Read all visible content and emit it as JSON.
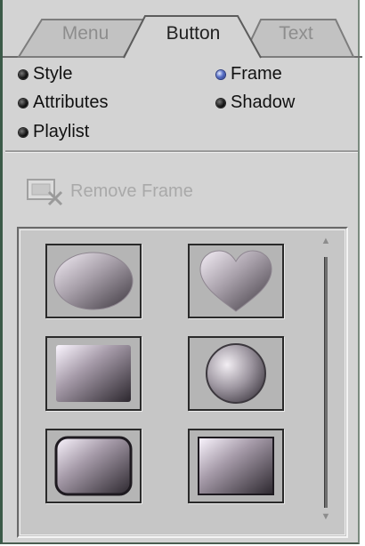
{
  "tabs": [
    {
      "label": "Menu",
      "active": false
    },
    {
      "label": "Button",
      "active": true
    },
    {
      "label": "Text",
      "active": false
    }
  ],
  "options": {
    "style": {
      "label": "Style",
      "selected": false
    },
    "attributes": {
      "label": "Attributes",
      "selected": false
    },
    "playlist": {
      "label": "Playlist",
      "selected": false
    },
    "frame": {
      "label": "Frame",
      "selected": true
    },
    "shadow": {
      "label": "Shadow",
      "selected": false
    }
  },
  "remove_frame": {
    "label": "Remove Frame",
    "enabled": false
  },
  "frames": [
    {
      "shape": "ellipse"
    },
    {
      "shape": "heart"
    },
    {
      "shape": "soft-rectangle"
    },
    {
      "shape": "circle"
    },
    {
      "shape": "rounded-rectangle"
    },
    {
      "shape": "rectangle"
    }
  ],
  "colors": {
    "panel": "#d3d3d3",
    "selected_radio": "#4a62c0",
    "disabled_text": "#a9a9a9"
  }
}
